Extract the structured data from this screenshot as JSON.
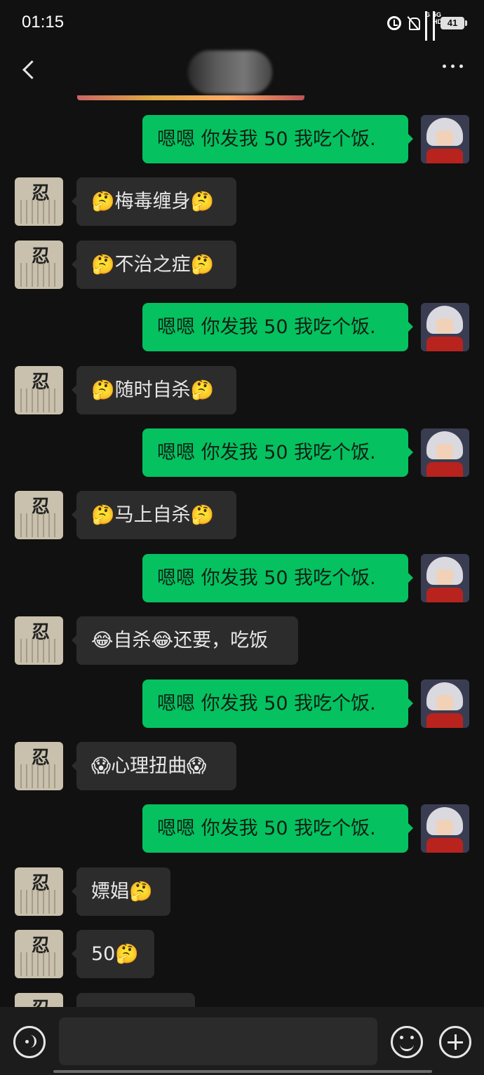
{
  "status_bar": {
    "time": "01:15",
    "network": "5G HD",
    "carrier_mark": "G",
    "battery": "41",
    "icons": [
      "alarm-icon",
      "mute-icon",
      "signal-icon",
      "signal-5g-icon",
      "battery-icon"
    ]
  },
  "nav": {
    "back_icon": "chevron-left",
    "more_icon": "more-dots"
  },
  "messages": [
    {
      "side": "out",
      "text": "嗯嗯  你发我 50 我吃个饭."
    },
    {
      "side": "in",
      "text": "🤔梅毒缠身🤔"
    },
    {
      "side": "in",
      "text": "🤔不治之症🤔"
    },
    {
      "side": "out",
      "text": "嗯嗯  你发我 50 我吃个饭."
    },
    {
      "side": "in",
      "text": "🤔随时自杀🤔"
    },
    {
      "side": "out",
      "text": "嗯嗯  你发我 50 我吃个饭."
    },
    {
      "side": "in",
      "text": "🤔马上自杀🤔"
    },
    {
      "side": "out",
      "text": "嗯嗯  你发我 50 我吃个饭."
    },
    {
      "side": "in",
      "text": "😂自杀😂还要，吃饭"
    },
    {
      "side": "out",
      "text": "嗯嗯  你发我 50 我吃个饭."
    },
    {
      "side": "in",
      "text": "😱心理扭曲😱"
    },
    {
      "side": "out",
      "text": "嗯嗯  你发我 50 我吃个饭."
    },
    {
      "side": "in",
      "text": "嫖娼🤔"
    },
    {
      "side": "in",
      "text": "50🤔"
    },
    {
      "side": "in",
      "text": ""
    }
  ],
  "input": {
    "value": "",
    "placeholder": ""
  },
  "colors": {
    "background": "#111111",
    "bubble_out": "#05c160",
    "bubble_in": "#2c2c2c",
    "input_bar": "#1c1c1c"
  }
}
